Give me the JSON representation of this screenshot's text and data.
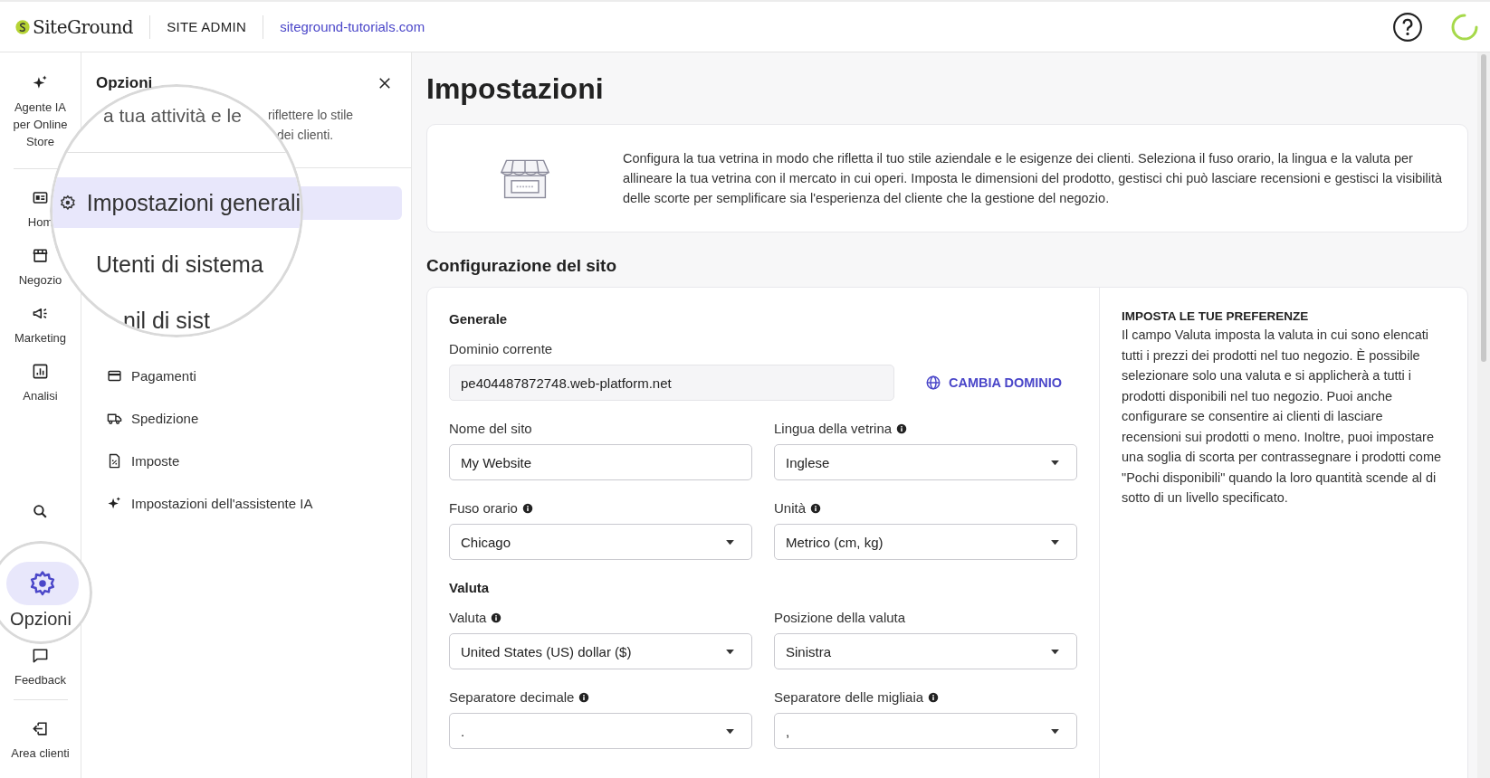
{
  "header": {
    "logo": "SiteGround",
    "section": "SITE ADMIN",
    "site_link": "siteground-tutorials.com"
  },
  "rail": {
    "items": [
      {
        "kind": "sparkle",
        "label": "Agente IA per Online Store",
        "selected": false
      },
      {
        "kind": "home",
        "label": "Hom",
        "selected": false
      },
      {
        "kind": "store",
        "label": "Negozio",
        "selected": false
      },
      {
        "kind": "megaphone",
        "label": "Marketing",
        "selected": false
      },
      {
        "kind": "chart",
        "label": "Analisi",
        "selected": false
      },
      {
        "kind": "search",
        "selected": false
      },
      {
        "kind": "gear",
        "label": "Opzioni",
        "selected": true
      },
      {
        "kind": "chat",
        "label": "Feedback",
        "selected": false
      },
      {
        "kind": "exit",
        "label": "Area clienti",
        "selected": false
      }
    ]
  },
  "panel": {
    "title": "Opzioni",
    "description_fragments": [
      "riflettere lo stile",
      "dei clienti."
    ],
    "lens": {
      "caption": "a tua attività e le",
      "lines": [
        {
          "label": "Impostazioni generali",
          "kind": "gear",
          "selected": true
        },
        {
          "label": "Utenti di sistema",
          "kind": "plain",
          "selected": false
        },
        {
          "label": "nil di sist",
          "kind": "plain",
          "selected": false
        }
      ]
    },
    "items": [
      {
        "kind": "card",
        "label": "Pagamenti"
      },
      {
        "kind": "truck",
        "label": "Spedizione"
      },
      {
        "kind": "tax",
        "label": "Imposte"
      },
      {
        "kind": "sparkle",
        "label": "Impostazioni dell'assistente IA"
      }
    ]
  },
  "main": {
    "title": "Impostazioni",
    "intro": "Configura la tua vetrina in modo che rifletta il tuo stile aziendale e le esigenze dei clienti. Seleziona il fuso orario, la lingua e la valuta per allineare la tua vetrina con il mercato in cui operi. Imposta le dimensioni del prodotto, gestisci chi può lasciare recensioni e gestisci la visibilità delle scorte per semplificare sia l'esperienza del cliente che la gestione del negozio.",
    "section_title": "Configurazione del sito",
    "groups": [
      {
        "heading": "Generale",
        "rows": [
          [
            {
              "kind": "readonly",
              "label": "Dominio corrente",
              "info": false,
              "value": "pe404487872748.web-platform.net",
              "action": "CAMBIA DOMINIO"
            }
          ],
          [
            {
              "kind": "text",
              "label": "Nome del sito",
              "info": false,
              "value": "My Website"
            },
            {
              "kind": "select",
              "label": "Lingua della vetrina",
              "info": true,
              "value": "Inglese"
            }
          ],
          [
            {
              "kind": "select",
              "label": "Fuso orario",
              "info": true,
              "value": "Chicago"
            },
            {
              "kind": "select",
              "label": "Unità",
              "info": true,
              "value": "Metrico (cm, kg)"
            }
          ]
        ]
      },
      {
        "heading": "Valuta",
        "rows": [
          [
            {
              "kind": "select",
              "label": "Valuta",
              "info": true,
              "value": "United States (US) dollar ($)"
            },
            {
              "kind": "select",
              "label": "Posizione della valuta",
              "info": false,
              "value": "Sinistra"
            }
          ],
          [
            {
              "kind": "select",
              "label": "Separatore decimale",
              "info": true,
              "value": "."
            },
            {
              "kind": "select",
              "label": "Separatore delle migliaia",
              "info": true,
              "value": ","
            }
          ]
        ]
      }
    ],
    "side": {
      "heading": "IMPOSTA LE TUE PREFERENZE",
      "text": "Il campo Valuta imposta la valuta in cui sono elencati tutti i prezzi dei prodotti nel tuo negozio. È possibile selezionare solo una valuta e si applicherà a tutti i prodotti disponibili nel tuo negozio. Puoi anche configurare se consentire ai clienti di lasciare recensioni sui prodotti o meno. Inoltre, puoi impostare una soglia di scorta per contrassegnare i prodotti come \"Pochi disponibili\" quando la loro quantità scende al di sotto di un livello specificato."
    }
  }
}
